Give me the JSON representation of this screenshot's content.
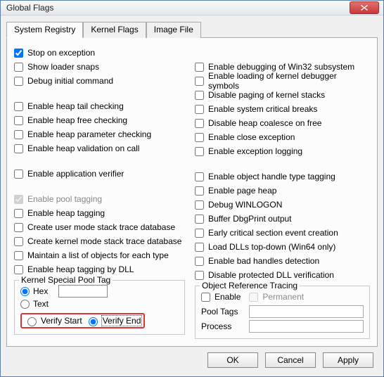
{
  "window": {
    "title": "Global Flags"
  },
  "tabs": [
    {
      "label": "System Registry",
      "active": true
    },
    {
      "label": "Kernel Flags",
      "active": false
    },
    {
      "label": "Image File",
      "active": false
    }
  ],
  "left": {
    "stop_exception": "Stop on exception",
    "show_loader": "Show loader snaps",
    "debug_initial": "Debug initial command",
    "heap_tail": "Enable heap tail checking",
    "heap_free": "Enable heap free checking",
    "heap_param": "Enable heap parameter checking",
    "heap_valid": "Enable heap validation on call",
    "app_verifier": "Enable application verifier",
    "pool_tagging": "Enable pool tagging",
    "heap_tagging": "Enable heap tagging",
    "user_stack": "Create user mode stack trace database",
    "kernel_stack": "Create kernel mode stack trace database",
    "maintain_list": "Maintain a list of objects for each type",
    "heap_tag_dll": "Enable heap tagging by DLL"
  },
  "right": {
    "win32_debug": "Enable debugging of Win32 subsystem",
    "kernel_symbols": "Enable loading of kernel debugger symbols",
    "disable_paging": "Disable paging of kernel stacks",
    "sys_critical": "Enable system critical breaks",
    "disable_coalesce": "Disable heap coalesce on free",
    "close_exc": "Enable close exception",
    "exc_logging": "Enable exception logging",
    "obj_handle": "Enable object handle type tagging",
    "page_heap": "Enable page heap",
    "debug_winlogon": "Debug WINLOGON",
    "buffer_dbg": "Buffer DbgPrint output",
    "early_critical": "Early critical section event creation",
    "load_dlls": "Load DLLs top-down (Win64 only)",
    "bad_handles": "Enable bad handles detection",
    "disable_dll_verif": "Disable protected DLL verification"
  },
  "kspt": {
    "legend": "Kernel Special Pool Tag",
    "hex": "Hex",
    "text": "Text",
    "verify_start": "Verify Start",
    "verify_end": "Verify End",
    "value": ""
  },
  "ort": {
    "legend": "Object Reference Tracing",
    "enable": "Enable",
    "permanent": "Permanent",
    "pool_tags_label": "Pool Tags",
    "process_label": "Process",
    "pool_tags": "",
    "process": ""
  },
  "buttons": {
    "ok": "OK",
    "cancel": "Cancel",
    "apply": "Apply"
  }
}
